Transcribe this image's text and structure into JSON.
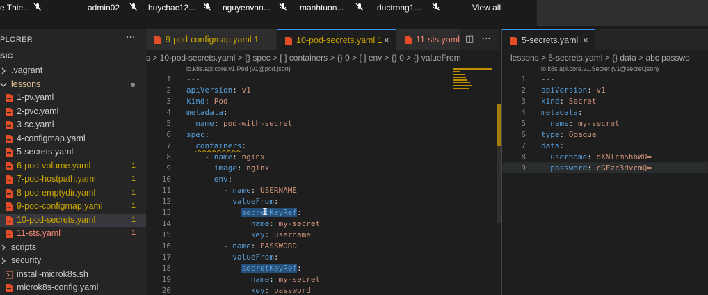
{
  "participants": {
    "names": [
      "e Thie...",
      "admin02",
      "huychac12...",
      "nguyenvan...",
      "manhtuon...",
      "ductrong1..."
    ],
    "view_all_label": "View all",
    "mic_icon": "mic-off-icon"
  },
  "sidebar": {
    "title": "PLORER",
    "more_label": "···",
    "folder": "SIC",
    "items": [
      {
        "label": ".vagrant",
        "type": "folder",
        "color": "#cccccc"
      },
      {
        "label": "lessons",
        "type": "folder-open",
        "color": "#e2c08d",
        "modified": true
      },
      {
        "label": "1-pv.yaml",
        "type": "yaml",
        "color": "#cccccc"
      },
      {
        "label": "2-pvc.yaml",
        "type": "yaml",
        "color": "#cccccc"
      },
      {
        "label": "3-sc.yaml",
        "type": "yaml",
        "color": "#cccccc"
      },
      {
        "label": "4-configmap.yaml",
        "type": "yaml",
        "color": "#cccccc"
      },
      {
        "label": "5-secrets.yaml",
        "type": "yaml",
        "color": "#cccccc"
      },
      {
        "label": "6-pod-volume.yaml",
        "type": "yaml",
        "color": "#cca700",
        "badge": "1"
      },
      {
        "label": "7-pod-hostpath.yaml",
        "type": "yaml",
        "color": "#cca700",
        "badge": "1"
      },
      {
        "label": "8-pod-emptydir.yaml",
        "type": "yaml",
        "color": "#cca700",
        "badge": "1"
      },
      {
        "label": "9-pod-configmap.yaml",
        "type": "yaml",
        "color": "#cca700",
        "badge": "1"
      },
      {
        "label": "10-pod-secrets.yaml",
        "type": "yaml",
        "color": "#cca700",
        "badge": "1",
        "selected": true
      },
      {
        "label": "11-sts.yaml",
        "type": "yaml",
        "color": "#f48771",
        "badge": "1"
      },
      {
        "label": "scripts",
        "type": "folder",
        "color": "#cccccc"
      },
      {
        "label": "security",
        "type": "folder",
        "color": "#cccccc"
      },
      {
        "label": "install-microk8s.sh",
        "type": "shell",
        "color": "#cccccc"
      },
      {
        "label": "microk8s-config.yaml",
        "type": "yaml",
        "color": "#cccccc"
      }
    ]
  },
  "tabs_left": [
    {
      "label": "9-pod-configmap.yaml 1",
      "color": "#cca700",
      "active": false
    },
    {
      "label": "10-pod-secrets.yaml 1",
      "color": "#cca700",
      "active": true,
      "close": "×"
    },
    {
      "label": "11-sts.yaml",
      "color": "#f48771",
      "active": false
    }
  ],
  "tabs_right": [
    {
      "label": "5-secrets.yaml",
      "color": "#cccccc",
      "active": true,
      "close": "×"
    }
  ],
  "split_icon": "split-editor-icon",
  "more_icon": "···",
  "breadcrumb_left": "s > 10-pod-secrets.yaml > {} spec > [ ] containers > {} 0 > [ ] env > {} 0 > {} valueFrom",
  "breadcrumb_right": "lessons > 5-secrets.yaml > {} data > abc passwo",
  "schema_left": "io.k8s.api.core.v1.Pod (v1@pod.json)",
  "schema_right": "io.k8s.api.core.v1.Secret (v1@secret.json)",
  "code_left": [
    {
      "n": "1",
      "text": "---",
      "parts": [
        [
          "p",
          "---"
        ]
      ]
    },
    {
      "n": "2",
      "parts": [
        [
          "k",
          "apiVersion"
        ],
        [
          "p",
          ": "
        ],
        [
          "s",
          "v1"
        ]
      ]
    },
    {
      "n": "3",
      "parts": [
        [
          "k",
          "kind"
        ],
        [
          "p",
          ": "
        ],
        [
          "s",
          "Pod"
        ]
      ]
    },
    {
      "n": "4",
      "parts": [
        [
          "k",
          "metadata"
        ],
        [
          "p",
          ":"
        ]
      ]
    },
    {
      "n": "5",
      "parts": [
        [
          "p",
          "  "
        ],
        [
          "k",
          "name"
        ],
        [
          "p",
          ": "
        ],
        [
          "s",
          "pod-with-secret"
        ]
      ]
    },
    {
      "n": "6",
      "parts": [
        [
          "k",
          "spec"
        ],
        [
          "p",
          ":"
        ]
      ]
    },
    {
      "n": "7",
      "parts": [
        [
          "p",
          "  "
        ],
        [
          "k",
          "containers",
          "squig"
        ],
        [
          "p",
          ":"
        ]
      ]
    },
    {
      "n": "8",
      "parts": [
        [
          "p",
          "    - "
        ],
        [
          "k",
          "name"
        ],
        [
          "p",
          ": "
        ],
        [
          "s",
          "nginx"
        ]
      ]
    },
    {
      "n": "9",
      "parts": [
        [
          "p",
          "      "
        ],
        [
          "k",
          "image"
        ],
        [
          "p",
          ": "
        ],
        [
          "s",
          "nginx"
        ]
      ]
    },
    {
      "n": "10",
      "parts": [
        [
          "p",
          "      "
        ],
        [
          "k",
          "env"
        ],
        [
          "p",
          ":"
        ]
      ]
    },
    {
      "n": "11",
      "parts": [
        [
          "p",
          "        - "
        ],
        [
          "k",
          "name"
        ],
        [
          "p",
          ": "
        ],
        [
          "s",
          "USERNAME"
        ]
      ]
    },
    {
      "n": "12",
      "parts": [
        [
          "p",
          "          "
        ],
        [
          "k",
          "valueFrom"
        ],
        [
          "p",
          ":"
        ]
      ]
    },
    {
      "n": "13",
      "parts": [
        [
          "p",
          "            "
        ],
        [
          "k",
          "secretKeyRef",
          "hl"
        ],
        [
          "p",
          ":"
        ]
      ]
    },
    {
      "n": "14",
      "parts": [
        [
          "p",
          "              "
        ],
        [
          "k",
          "name"
        ],
        [
          "p",
          ": "
        ],
        [
          "s",
          "my-secret"
        ]
      ]
    },
    {
      "n": "15",
      "parts": [
        [
          "p",
          "              "
        ],
        [
          "k",
          "key"
        ],
        [
          "p",
          ": "
        ],
        [
          "s",
          "username"
        ]
      ]
    },
    {
      "n": "16",
      "parts": [
        [
          "p",
          "        - "
        ],
        [
          "k",
          "name"
        ],
        [
          "p",
          ": "
        ],
        [
          "s",
          "PASSWORD"
        ]
      ]
    },
    {
      "n": "17",
      "parts": [
        [
          "p",
          "          "
        ],
        [
          "k",
          "valueFrom"
        ],
        [
          "p",
          ":"
        ]
      ]
    },
    {
      "n": "18",
      "parts": [
        [
          "p",
          "            "
        ],
        [
          "k",
          "secretKeyRef",
          "hl"
        ],
        [
          "p",
          ":"
        ]
      ]
    },
    {
      "n": "19",
      "parts": [
        [
          "p",
          "              "
        ],
        [
          "k",
          "name"
        ],
        [
          "p",
          ": "
        ],
        [
          "s",
          "my-secret"
        ]
      ]
    },
    {
      "n": "20",
      "parts": [
        [
          "p",
          "              "
        ],
        [
          "k",
          "key"
        ],
        [
          "p",
          ": "
        ],
        [
          "s",
          "password"
        ]
      ]
    }
  ],
  "code_right": [
    {
      "n": "1",
      "parts": [
        [
          "p",
          "---"
        ]
      ]
    },
    {
      "n": "2",
      "parts": [
        [
          "k",
          "apiVersion"
        ],
        [
          "p",
          ": "
        ],
        [
          "s",
          "v1"
        ]
      ]
    },
    {
      "n": "3",
      "parts": [
        [
          "k",
          "kind"
        ],
        [
          "p",
          ": "
        ],
        [
          "s",
          "Secret"
        ]
      ]
    },
    {
      "n": "4",
      "parts": [
        [
          "k",
          "metadata"
        ],
        [
          "p",
          ":"
        ]
      ]
    },
    {
      "n": "5",
      "parts": [
        [
          "p",
          "  "
        ],
        [
          "k",
          "name"
        ],
        [
          "p",
          ": "
        ],
        [
          "s",
          "my-secret"
        ]
      ]
    },
    {
      "n": "6",
      "parts": [
        [
          "k",
          "type"
        ],
        [
          "p",
          ": "
        ],
        [
          "s",
          "Opaque"
        ]
      ]
    },
    {
      "n": "7",
      "parts": [
        [
          "k",
          "data"
        ],
        [
          "p",
          ":"
        ]
      ]
    },
    {
      "n": "8",
      "parts": [
        [
          "p",
          "  "
        ],
        [
          "k",
          "username"
        ],
        [
          "p",
          ": "
        ],
        [
          "s",
          "dXNlcm5hbWU="
        ]
      ]
    },
    {
      "n": "9",
      "parts": [
        [
          "p",
          "  "
        ],
        [
          "k",
          "password"
        ],
        [
          "p",
          ": "
        ],
        [
          "s",
          "cGFzc3dvcmQ="
        ]
      ]
    }
  ],
  "colors": {
    "accent": "#3794ff",
    "warning": "#cca700",
    "error": "#f48771",
    "yaml_icon": "#e44d26"
  }
}
